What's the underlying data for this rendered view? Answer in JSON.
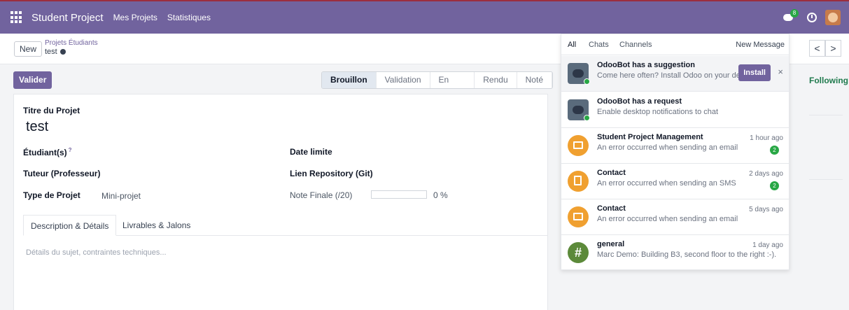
{
  "navbar": {
    "app_name": "Student Project",
    "menu": [
      "Mes Projets",
      "Statistiques"
    ],
    "chat_badge": "8",
    "icons": [
      "apps-icon",
      "chat-icon",
      "clock-icon",
      "user-avatar"
    ]
  },
  "control": {
    "new_label": "New",
    "breadcrumb_parent": "Projets Étudiants",
    "breadcrumb_current": "test"
  },
  "statusbar": {
    "validate_label": "Valider",
    "stages": [
      "Brouillon",
      "Validation",
      "En cours",
      "Rendu",
      "Noté"
    ],
    "active_stage": "Brouillon"
  },
  "form": {
    "title_label": "Titre du Projet",
    "title_value": "test",
    "students_label": "Étudiant(s)",
    "students_help": "?",
    "deadline_label": "Date limite",
    "tutor_label": "Tuteur (Professeur)",
    "repo_label": "Lien Repository (Git)",
    "type_label": "Type de Projet",
    "type_value": "Mini-projet",
    "grade_label": "Note Finale (/20)",
    "grade_value": "0 %",
    "grade_fraction": 0,
    "tabs": [
      "Description & Détails",
      "Livrables & Jalons"
    ],
    "description_placeholder": "Détails du sujet, contraintes techniques..."
  },
  "chatter": {
    "following_label": "Following",
    "pager_prev": "<",
    "pager_next": ">"
  },
  "messaging": {
    "tabs": [
      "All",
      "Chats",
      "Channels"
    ],
    "new_message": "New Message",
    "install_label": "Install",
    "close_glyph": "×",
    "items": [
      {
        "title": "OdooBot has a suggestion",
        "text": "Come here often? Install Odoo on your devi...",
        "time": "",
        "count": ""
      },
      {
        "title": "OdooBot has a request",
        "text": "Enable desktop notifications to chat",
        "time": "",
        "count": ""
      },
      {
        "title": "Student Project Management",
        "text": "An error occurred when sending an email",
        "time": "1 hour ago",
        "count": "2"
      },
      {
        "title": "Contact",
        "text": "An error occurred when sending an SMS",
        "time": "2 days ago",
        "count": "2"
      },
      {
        "title": "Contact",
        "text": "An error occurred when sending an email",
        "time": "5 days ago",
        "count": ""
      },
      {
        "title": "general",
        "text": "Marc Demo: Building B3, second floor to the right :-).",
        "time": "1 day ago",
        "count": ""
      }
    ],
    "hash_glyph": "#"
  },
  "colors": {
    "navbar": "#71639e",
    "primary": "#71639e",
    "success": "#28a745",
    "warning": "#f0a030"
  }
}
